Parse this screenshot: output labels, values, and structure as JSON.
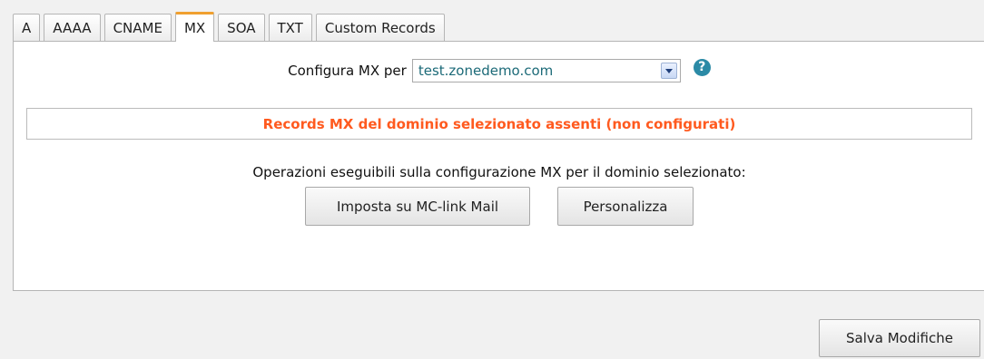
{
  "tabs": [
    {
      "label": "A",
      "active": false
    },
    {
      "label": "AAAA",
      "active": false
    },
    {
      "label": "CNAME",
      "active": false
    },
    {
      "label": "MX",
      "active": true
    },
    {
      "label": "SOA",
      "active": false
    },
    {
      "label": "TXT",
      "active": false
    },
    {
      "label": "Custom Records",
      "active": false
    }
  ],
  "config": {
    "label": "Configura MX per",
    "domain_selected": "test.zonedemo.com",
    "help_icon": "question-circle-icon"
  },
  "notice": {
    "text": "Records MX del dominio selezionato assenti (non configurati)",
    "color": "#ff5a1f"
  },
  "operations": {
    "text": "Operazioni eseguibili sulla configurazione MX per il dominio selezionato:",
    "buttons": {
      "mclink": "Imposta su MC-link Mail",
      "custom": "Personalizza"
    }
  },
  "footer": {
    "save_label": "Salva Modifiche"
  },
  "colors": {
    "active_tab_accent": "#f0a030",
    "domain_text": "#1c6a78",
    "help_icon": "#2b8aa6"
  }
}
